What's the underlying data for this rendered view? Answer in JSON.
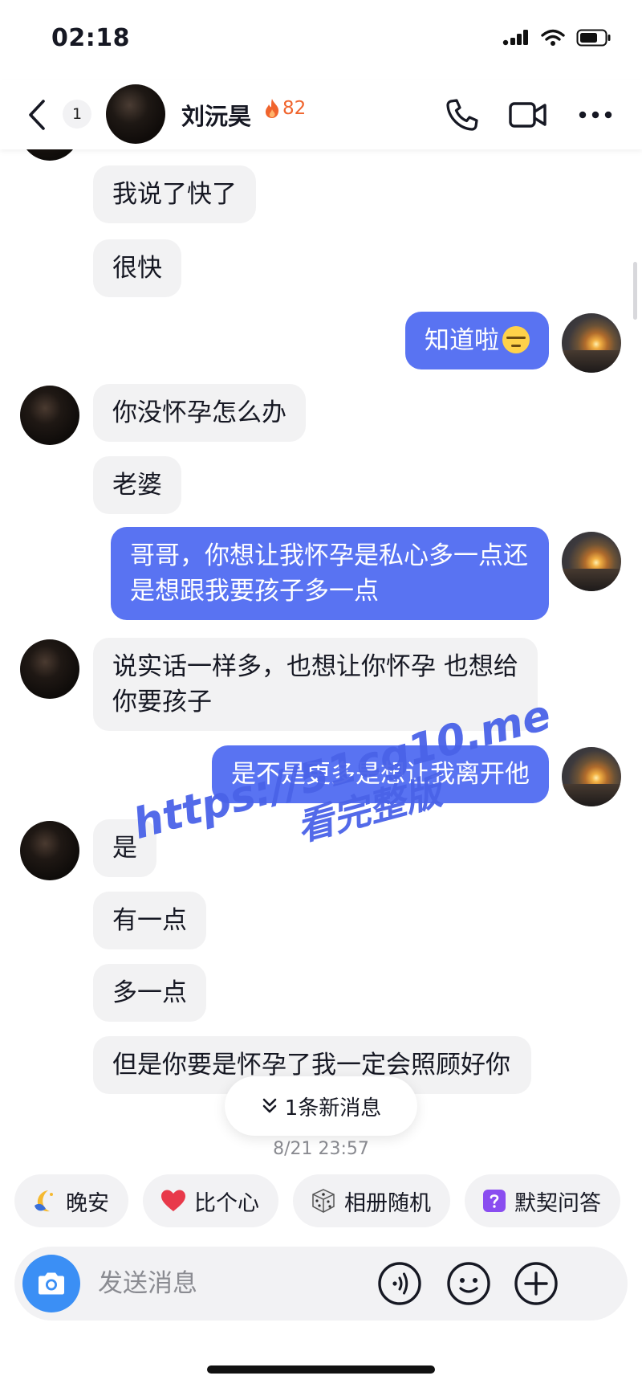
{
  "status_bar": {
    "time": "02:18",
    "icons": [
      "signal-icon",
      "wifi-icon",
      "battery-icon"
    ]
  },
  "header": {
    "back_icon": "chevron-left-icon",
    "unread_count": "1",
    "contact_name": "刘沅昊",
    "streak_icon": "flame-icon",
    "streak_count": "82",
    "actions": [
      "phone-icon",
      "video-camera-icon",
      "more-icon"
    ]
  },
  "messages": [
    {
      "side": "in",
      "text": "我说了快了"
    },
    {
      "side": "in",
      "text": "很快"
    },
    {
      "side": "out",
      "text": "知道啦",
      "emoji": "smirk-emoji"
    },
    {
      "side": "in",
      "text": "你没怀孕怎么办"
    },
    {
      "side": "in",
      "text": "老婆"
    },
    {
      "side": "out",
      "text": "哥哥，你想让我怀孕是私心多一点还是想跟我要孩子多一点"
    },
    {
      "side": "in",
      "text": "说实话一样多，也想让你怀孕 也想给你要孩子"
    },
    {
      "side": "out",
      "text": "是不是更多是想让我离开他"
    },
    {
      "side": "in",
      "text": "是"
    },
    {
      "side": "in",
      "text": "有一点"
    },
    {
      "side": "in",
      "text": "多一点"
    },
    {
      "side": "in",
      "text": "但是你要是怀孕了我一定会照顾好你"
    }
  ],
  "new_message_pill": {
    "icon": "double-chevron-down-icon",
    "label": "1条新消息"
  },
  "timestamp": "8/21 23:57",
  "watermark": {
    "line1": "https://51cg10.me",
    "line2": "看完整版"
  },
  "quick_actions": [
    {
      "icon": "moon-icon",
      "label": "晚安"
    },
    {
      "icon": "heart-icon",
      "label": "比个心"
    },
    {
      "icon": "dice-icon",
      "label": "相册随机"
    },
    {
      "icon": "question-box-icon",
      "label": "默契问答"
    }
  ],
  "input": {
    "placeholder": "发送消息",
    "camera_icon": "camera-icon",
    "voice_icon": "voice-icon",
    "emoji_icon": "emoji-icon",
    "plus_icon": "plus-icon"
  },
  "colors": {
    "outgoing_bubble": "#5973f2",
    "incoming_bubble": "#f2f2f3",
    "camera_button": "#3b8ff5",
    "streak": "#f0642d",
    "watermark": "#4a63e8"
  }
}
